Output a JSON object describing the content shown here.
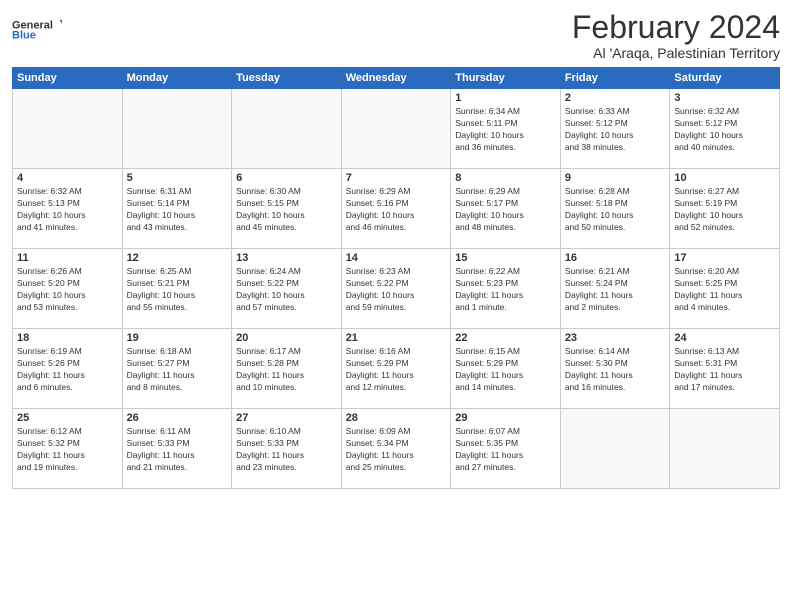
{
  "logo": {
    "general": "General",
    "blue": "Blue"
  },
  "header": {
    "month": "February 2024",
    "location": "Al 'Araqa, Palestinian Territory"
  },
  "days": [
    "Sunday",
    "Monday",
    "Tuesday",
    "Wednesday",
    "Thursday",
    "Friday",
    "Saturday"
  ],
  "weeks": [
    [
      {
        "day": "",
        "info": ""
      },
      {
        "day": "",
        "info": ""
      },
      {
        "day": "",
        "info": ""
      },
      {
        "day": "",
        "info": ""
      },
      {
        "day": "1",
        "info": "Sunrise: 6:34 AM\nSunset: 5:11 PM\nDaylight: 10 hours\nand 36 minutes."
      },
      {
        "day": "2",
        "info": "Sunrise: 6:33 AM\nSunset: 5:12 PM\nDaylight: 10 hours\nand 38 minutes."
      },
      {
        "day": "3",
        "info": "Sunrise: 6:32 AM\nSunset: 5:12 PM\nDaylight: 10 hours\nand 40 minutes."
      }
    ],
    [
      {
        "day": "4",
        "info": "Sunrise: 6:32 AM\nSunset: 5:13 PM\nDaylight: 10 hours\nand 41 minutes."
      },
      {
        "day": "5",
        "info": "Sunrise: 6:31 AM\nSunset: 5:14 PM\nDaylight: 10 hours\nand 43 minutes."
      },
      {
        "day": "6",
        "info": "Sunrise: 6:30 AM\nSunset: 5:15 PM\nDaylight: 10 hours\nand 45 minutes."
      },
      {
        "day": "7",
        "info": "Sunrise: 6:29 AM\nSunset: 5:16 PM\nDaylight: 10 hours\nand 46 minutes."
      },
      {
        "day": "8",
        "info": "Sunrise: 6:29 AM\nSunset: 5:17 PM\nDaylight: 10 hours\nand 48 minutes."
      },
      {
        "day": "9",
        "info": "Sunrise: 6:28 AM\nSunset: 5:18 PM\nDaylight: 10 hours\nand 50 minutes."
      },
      {
        "day": "10",
        "info": "Sunrise: 6:27 AM\nSunset: 5:19 PM\nDaylight: 10 hours\nand 52 minutes."
      }
    ],
    [
      {
        "day": "11",
        "info": "Sunrise: 6:26 AM\nSunset: 5:20 PM\nDaylight: 10 hours\nand 53 minutes."
      },
      {
        "day": "12",
        "info": "Sunrise: 6:25 AM\nSunset: 5:21 PM\nDaylight: 10 hours\nand 55 minutes."
      },
      {
        "day": "13",
        "info": "Sunrise: 6:24 AM\nSunset: 5:22 PM\nDaylight: 10 hours\nand 57 minutes."
      },
      {
        "day": "14",
        "info": "Sunrise: 6:23 AM\nSunset: 5:22 PM\nDaylight: 10 hours\nand 59 minutes."
      },
      {
        "day": "15",
        "info": "Sunrise: 6:22 AM\nSunset: 5:23 PM\nDaylight: 11 hours\nand 1 minute."
      },
      {
        "day": "16",
        "info": "Sunrise: 6:21 AM\nSunset: 5:24 PM\nDaylight: 11 hours\nand 2 minutes."
      },
      {
        "day": "17",
        "info": "Sunrise: 6:20 AM\nSunset: 5:25 PM\nDaylight: 11 hours\nand 4 minutes."
      }
    ],
    [
      {
        "day": "18",
        "info": "Sunrise: 6:19 AM\nSunset: 5:26 PM\nDaylight: 11 hours\nand 6 minutes."
      },
      {
        "day": "19",
        "info": "Sunrise: 6:18 AM\nSunset: 5:27 PM\nDaylight: 11 hours\nand 8 minutes."
      },
      {
        "day": "20",
        "info": "Sunrise: 6:17 AM\nSunset: 5:28 PM\nDaylight: 11 hours\nand 10 minutes."
      },
      {
        "day": "21",
        "info": "Sunrise: 6:16 AM\nSunset: 5:29 PM\nDaylight: 11 hours\nand 12 minutes."
      },
      {
        "day": "22",
        "info": "Sunrise: 6:15 AM\nSunset: 5:29 PM\nDaylight: 11 hours\nand 14 minutes."
      },
      {
        "day": "23",
        "info": "Sunrise: 6:14 AM\nSunset: 5:30 PM\nDaylight: 11 hours\nand 16 minutes."
      },
      {
        "day": "24",
        "info": "Sunrise: 6:13 AM\nSunset: 5:31 PM\nDaylight: 11 hours\nand 17 minutes."
      }
    ],
    [
      {
        "day": "25",
        "info": "Sunrise: 6:12 AM\nSunset: 5:32 PM\nDaylight: 11 hours\nand 19 minutes."
      },
      {
        "day": "26",
        "info": "Sunrise: 6:11 AM\nSunset: 5:33 PM\nDaylight: 11 hours\nand 21 minutes."
      },
      {
        "day": "27",
        "info": "Sunrise: 6:10 AM\nSunset: 5:33 PM\nDaylight: 11 hours\nand 23 minutes."
      },
      {
        "day": "28",
        "info": "Sunrise: 6:09 AM\nSunset: 5:34 PM\nDaylight: 11 hours\nand 25 minutes."
      },
      {
        "day": "29",
        "info": "Sunrise: 6:07 AM\nSunset: 5:35 PM\nDaylight: 11 hours\nand 27 minutes."
      },
      {
        "day": "",
        "info": ""
      },
      {
        "day": "",
        "info": ""
      }
    ]
  ]
}
